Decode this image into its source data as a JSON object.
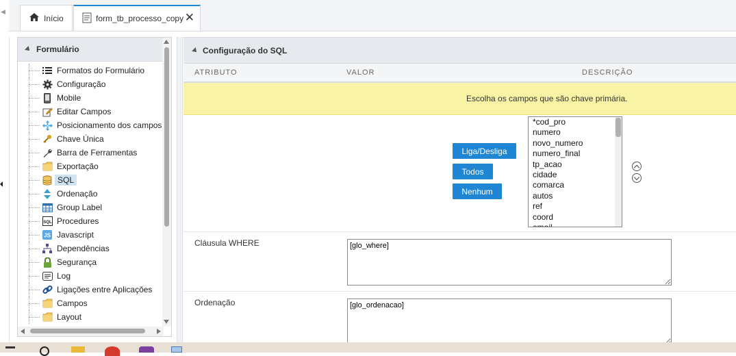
{
  "tabs": [
    {
      "label": "Início",
      "icon": "home-icon"
    },
    {
      "label": "form_tb_processo_copy",
      "icon": "form-icon",
      "close": "✕"
    }
  ],
  "sidebar": {
    "title": "Formulário",
    "items": [
      {
        "label": "Formatos do Formulário",
        "icon": "list-icon"
      },
      {
        "label": "Configuração",
        "icon": "gear-icon"
      },
      {
        "label": "Mobile",
        "icon": "mobile-icon"
      },
      {
        "label": "Editar Campos",
        "icon": "edit-icon"
      },
      {
        "label": "Posicionamento dos campos",
        "icon": "move-icon"
      },
      {
        "label": "Chave Única",
        "icon": "key-icon"
      },
      {
        "label": "Barra de Ferramentas",
        "icon": "wrench-icon"
      },
      {
        "label": "Exportação",
        "icon": "folder-icon"
      },
      {
        "label": "SQL",
        "icon": "database-icon",
        "selected": true
      },
      {
        "label": "Ordenação",
        "icon": "sort-icon"
      },
      {
        "label": "Group Label",
        "icon": "table-icon"
      },
      {
        "label": "Procedures",
        "icon": "sql-icon"
      },
      {
        "label": "Javascript",
        "icon": "javascript-icon"
      },
      {
        "label": "Dependências",
        "icon": "dependency-icon"
      },
      {
        "label": "Segurança",
        "icon": "lock-icon"
      },
      {
        "label": "Log",
        "icon": "log-icon"
      },
      {
        "label": "Ligações entre Aplicações",
        "icon": "link-icon"
      },
      {
        "label": "Campos",
        "icon": "folder-icon"
      },
      {
        "label": "Layout",
        "icon": "folder-icon"
      }
    ]
  },
  "main": {
    "title": "Configuração do SQL",
    "columns": {
      "attribute": "ATRIBUTO",
      "value": "VALOR",
      "description": "DESCRIÇÃO"
    },
    "notice": "Escolha os campos que são chave primária.",
    "buttons": {
      "toggle": "Liga/Desliga",
      "all": "Todos",
      "none": "Nenhum"
    },
    "pk_fields": [
      "*cod_pro",
      "numero",
      "novo_numero",
      "numero_final",
      "tp_acao",
      "cidade",
      "comarca",
      "autos",
      "ref",
      "coord",
      "email"
    ],
    "where": {
      "label": "Cláusula WHERE",
      "value": "[glo_where]"
    },
    "order": {
      "label": "Ordenação",
      "value": "[glo_ordenacao]"
    }
  },
  "colors": {
    "accent": "#1f86d3",
    "notice_bg": "#f9f3a6",
    "selected_bg": "#cfe3f3"
  }
}
